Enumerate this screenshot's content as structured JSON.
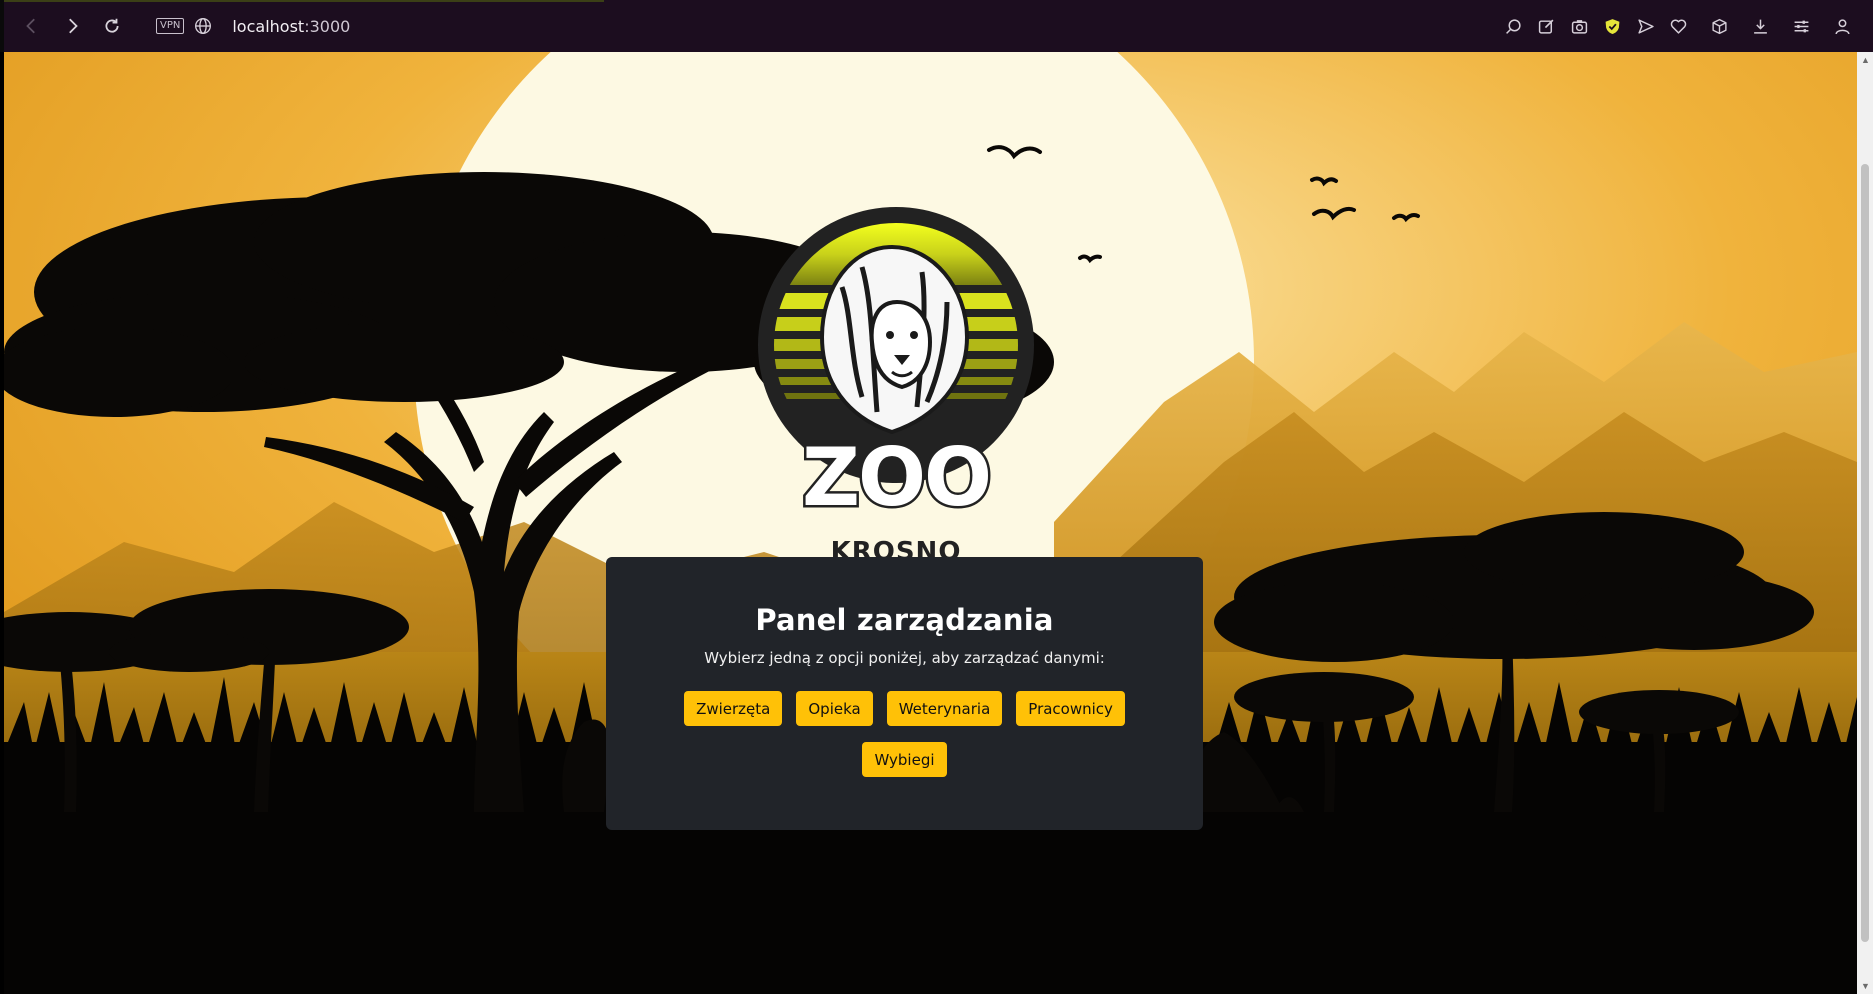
{
  "browser": {
    "vpn_label": "VPN",
    "url_host": "localhost",
    "url_port": ":3000"
  },
  "logo": {
    "title": "ZOO",
    "subtitle": "KROSNO"
  },
  "panel": {
    "title": "Panel zarządzania",
    "subtitle": "Wybierz jedną z opcji poniżej, aby zarządzać danymi:",
    "buttons": [
      "Zwierzęta",
      "Opieka",
      "Weterynaria",
      "Pracownicy",
      "Wybiegi"
    ]
  },
  "colors": {
    "accent": "#ffc107",
    "panel_bg": "#212429",
    "chrome_bg": "#1c0d1f"
  },
  "icons": [
    "back-icon",
    "forward-icon",
    "reload-icon",
    "globe-icon",
    "search-tab-icon",
    "edit-icon",
    "camera-icon",
    "shield-icon",
    "send-icon",
    "heart-icon",
    "box-icon",
    "download-icon",
    "settings-icon",
    "profile-icon"
  ]
}
